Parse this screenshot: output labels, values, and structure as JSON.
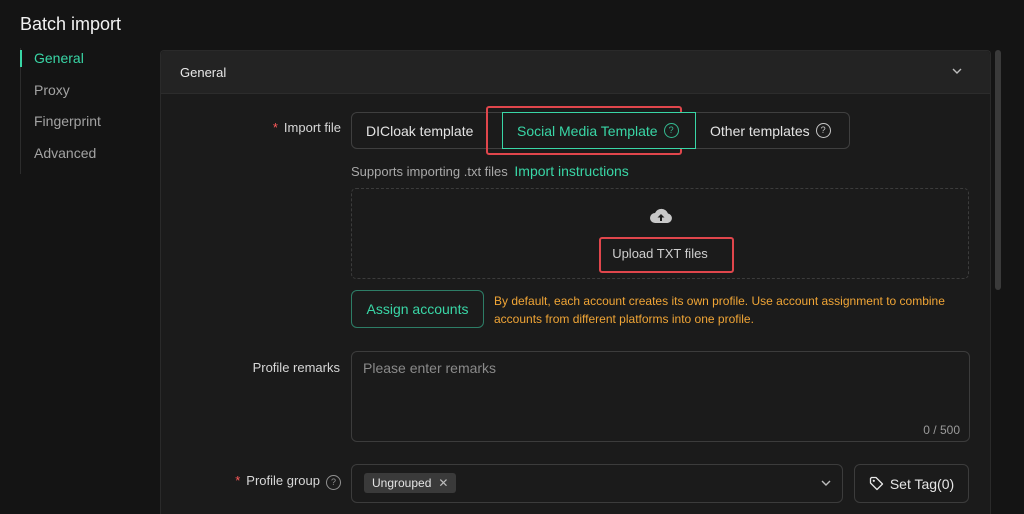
{
  "page": {
    "title": "Batch import"
  },
  "nav": {
    "items": [
      {
        "label": "General",
        "active": true
      },
      {
        "label": "Proxy"
      },
      {
        "label": "Fingerprint"
      },
      {
        "label": "Advanced"
      }
    ]
  },
  "panel": {
    "title": "General"
  },
  "import_file": {
    "label": "Import file",
    "templates": [
      "DICloak template",
      "Social Media Template",
      "Other templates"
    ],
    "active_template": "Social Media Template",
    "support_text": "Supports importing .txt files",
    "instructions_link": "Import instructions",
    "upload_label": "Upload TXT files",
    "assign_button": "Assign accounts",
    "assign_note": "By default, each account creates its own profile. Use account assignment to combine accounts from different platforms into one profile."
  },
  "remarks": {
    "label": "Profile remarks",
    "placeholder": "Please enter remarks",
    "counter": "0 / 500"
  },
  "profile_group": {
    "label": "Profile group",
    "selected_tag": "Ungrouped",
    "set_tag_button": "Set Tag(0)"
  },
  "colors": {
    "accent": "#39d6a6",
    "warning": "#f0a536",
    "required": "#ff5a5a",
    "highlight": "#e0464c",
    "background": "#141414"
  }
}
